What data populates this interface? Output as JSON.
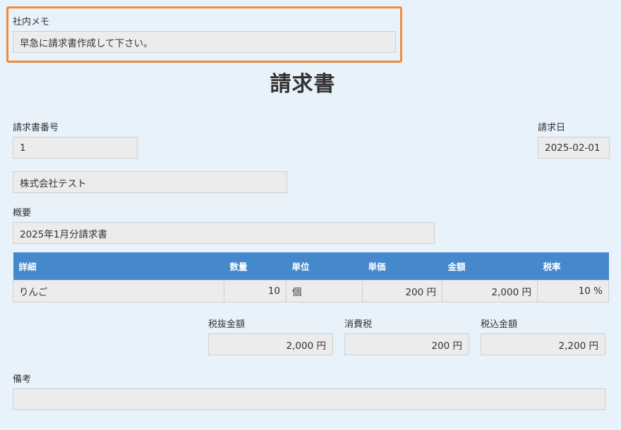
{
  "memo": {
    "label": "社内メモ",
    "value": "早急に請求書作成して下さい。",
    "highlight_color": "#f08a3e"
  },
  "title": "請求書",
  "invoice_number": {
    "label": "請求書番号",
    "value": "1"
  },
  "invoice_date": {
    "label": "請求日",
    "value": "2025-02-01"
  },
  "customer": {
    "value": "株式会社テスト"
  },
  "summary": {
    "label": "概要",
    "value": "2025年1月分請求書"
  },
  "details": {
    "header_color": "#4588cc",
    "columns": [
      "詳細",
      "数量",
      "単位",
      "単価",
      "金額",
      "税率"
    ],
    "rows": [
      {
        "item": "りんご",
        "qty": "10",
        "unit": "個",
        "unit_price": "200 円",
        "amount": "2,000 円",
        "tax_rate": "10 %"
      }
    ]
  },
  "totals": {
    "subtotal": {
      "label": "税抜金額",
      "value": "2,000 円"
    },
    "tax": {
      "label": "消費税",
      "value": "200 円"
    },
    "total": {
      "label": "税込金額",
      "value": "2,200 円"
    }
  },
  "notes": {
    "label": "備考",
    "value": ""
  }
}
